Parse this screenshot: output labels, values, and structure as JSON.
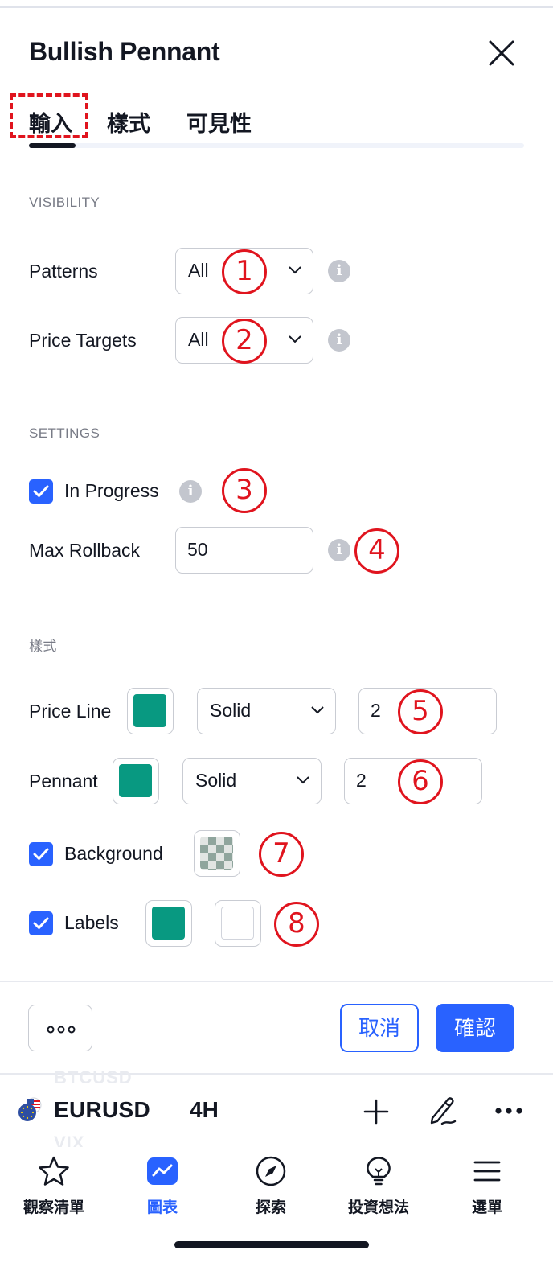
{
  "dialog": {
    "title": "Bullish Pennant",
    "tabs": [
      {
        "label": "輸入",
        "active": true
      },
      {
        "label": "樣式",
        "active": false
      },
      {
        "label": "可見性",
        "active": false
      }
    ]
  },
  "visibility": {
    "heading": "VISIBILITY",
    "patterns": {
      "label": "Patterns",
      "value": "All"
    },
    "price_targets": {
      "label": "Price Targets",
      "value": "All"
    }
  },
  "settings": {
    "heading": "SETTINGS",
    "in_progress": {
      "label": "In Progress",
      "checked": true
    },
    "max_rollback": {
      "label": "Max Rollback",
      "value": "50"
    }
  },
  "style": {
    "heading": "樣式",
    "price_line": {
      "label": "Price Line",
      "color": "#089981",
      "line_style": "Solid",
      "width": "2"
    },
    "pennant": {
      "label": "Pennant",
      "color": "#089981",
      "line_style": "Solid",
      "width": "2"
    },
    "background": {
      "label": "Background",
      "checked": true
    },
    "labels": {
      "label": "Labels",
      "checked": true,
      "color": "#089981",
      "text_color": "#ffffff"
    }
  },
  "annotations": [
    "1",
    "2",
    "3",
    "4",
    "5",
    "6",
    "7",
    "8"
  ],
  "footer": {
    "cancel": "取消",
    "confirm": "確認"
  },
  "symbol_bar": {
    "symbol": "EURUSD",
    "interval": "4H",
    "ghost_above": "BTCUSD",
    "ghost_below": "VIX"
  },
  "bottom_nav": [
    {
      "label": "觀察清單",
      "icon": "star-icon",
      "active": false
    },
    {
      "label": "圖表",
      "icon": "chart-icon",
      "active": true
    },
    {
      "label": "探索",
      "icon": "compass-icon",
      "active": false
    },
    {
      "label": "投資想法",
      "icon": "lightbulb-icon",
      "active": false
    },
    {
      "label": "選單",
      "icon": "menu-icon",
      "active": false
    }
  ],
  "colors": {
    "accent": "#2962ff",
    "green": "#089981",
    "annotation_red": "#e0141e"
  }
}
